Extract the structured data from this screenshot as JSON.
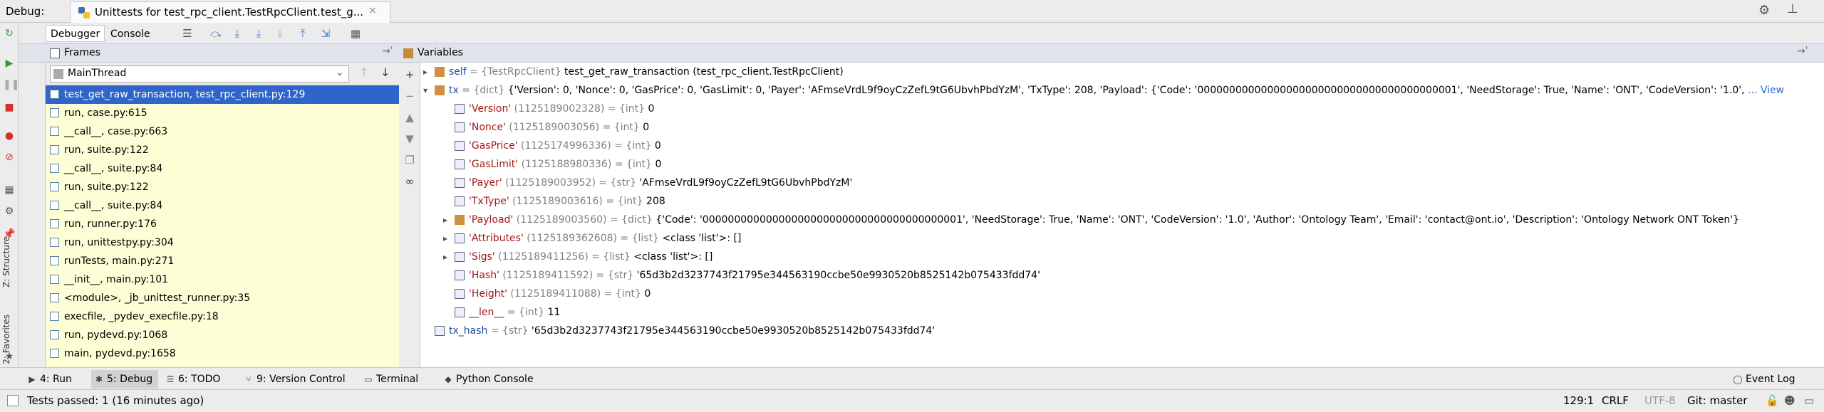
{
  "titlebar": {
    "debug_label": "Debug:",
    "tab_title": "Unittests for test_rpc_client.TestRpcClient.test_g...",
    "tab_close": "×"
  },
  "debug_toolbar": {
    "debugger_tab": "Debugger",
    "console_tab": "Console"
  },
  "frames": {
    "title": "Frames",
    "thread": "MainThread",
    "items": [
      "test_get_raw_transaction, test_rpc_client.py:129",
      "run, case.py:615",
      "__call__, case.py:663",
      "run, suite.py:122",
      "__call__, suite.py:84",
      "run, suite.py:122",
      "__call__, suite.py:84",
      "run, runner.py:176",
      "run, unittestpy.py:304",
      "runTests, main.py:271",
      "__init__, main.py:101",
      "<module>, _jb_unittest_runner.py:35",
      "execfile, _pydev_execfile.py:18",
      "run, pydevd.py:1068",
      "main, pydevd.py:1658"
    ]
  },
  "variables": {
    "title": "Variables",
    "view_link": "... View",
    "rows": [
      {
        "name": "self",
        "type": " = {TestRpcClient} ",
        "value": "test_get_raw_transaction (test_rpc_client.TestRpcClient)"
      },
      {
        "name": "tx",
        "type": " = {dict} ",
        "value": "{'Version': 0, 'Nonce': 0, 'GasPrice': 0, 'GasLimit': 0, 'Payer': 'AFmseVrdL9f9oyCzZefL9tG6UbvhPbdYzM', 'TxType': 208, 'Payload': {'Code': '00000000000000000000000000000000000000001', 'NeedStorage': True, 'Name': 'ONT', 'CodeVersion': '1.0', "
      },
      {
        "name": "'Version'",
        "type": " (1125189002328) = {int} ",
        "value": "0"
      },
      {
        "name": "'Nonce'",
        "type": " (1125189003056) = {int} ",
        "value": "0"
      },
      {
        "name": "'GasPrice'",
        "type": " (1125174996336) = {int} ",
        "value": "0"
      },
      {
        "name": "'GasLimit'",
        "type": " (1125188980336) = {int} ",
        "value": "0"
      },
      {
        "name": "'Payer'",
        "type": " (1125189003952) = {str} ",
        "value": "'AFmseVrdL9f9oyCzZefL9tG6UbvhPbdYzM'"
      },
      {
        "name": "'TxType'",
        "type": " (1125189003616) = {int} ",
        "value": "208"
      },
      {
        "name": "'Payload'",
        "type": " (1125189003560) = {dict} ",
        "value": "{'Code': '00000000000000000000000000000000000000001', 'NeedStorage': True, 'Name': 'ONT', 'CodeVersion': '1.0', 'Author': 'Ontology Team', 'Email': 'contact@ont.io', 'Description': 'Ontology Network ONT Token'}"
      },
      {
        "name": "'Attributes'",
        "type": " (1125189362608) = {list} ",
        "value": "<class 'list'>: []"
      },
      {
        "name": "'Sigs'",
        "type": " (1125189411256) = {list} ",
        "value": "<class 'list'>: []"
      },
      {
        "name": "'Hash'",
        "type": " (1125189411592) = {str} ",
        "value": "'65d3b2d3237743f21795e344563190ccbe50e9930520b8525142b075433fdd74'"
      },
      {
        "name": "'Height'",
        "type": " (1125189411088) = {int} ",
        "value": "0"
      },
      {
        "name": "__len__",
        "type": " = {int} ",
        "value": "11"
      },
      {
        "name": "tx_hash",
        "type": " = {str} ",
        "value": "'65d3b2d3237743f21795e344563190ccbe50e9930520b8525142b075433fdd74'"
      }
    ]
  },
  "sidebar": {
    "structure_label": "Z: Structure",
    "favorites_label": "2: Favorites"
  },
  "bottom_tabs": [
    {
      "label": "4: Run",
      "icon": "▶"
    },
    {
      "label": "5: Debug",
      "icon": "✱"
    },
    {
      "label": "6: TODO",
      "icon": "☰"
    },
    {
      "label": "9: Version Control",
      "icon": "⑂"
    },
    {
      "label": "Terminal",
      "icon": "▭"
    },
    {
      "label": "Python Console",
      "icon": "◆"
    }
  ],
  "event_log": "Event Log",
  "status": {
    "message": "Tests passed: 1 (16 minutes ago)",
    "position": "129:1",
    "line_ending": "CRLF",
    "encoding": "UTF-8",
    "vcs": "Git: master"
  }
}
